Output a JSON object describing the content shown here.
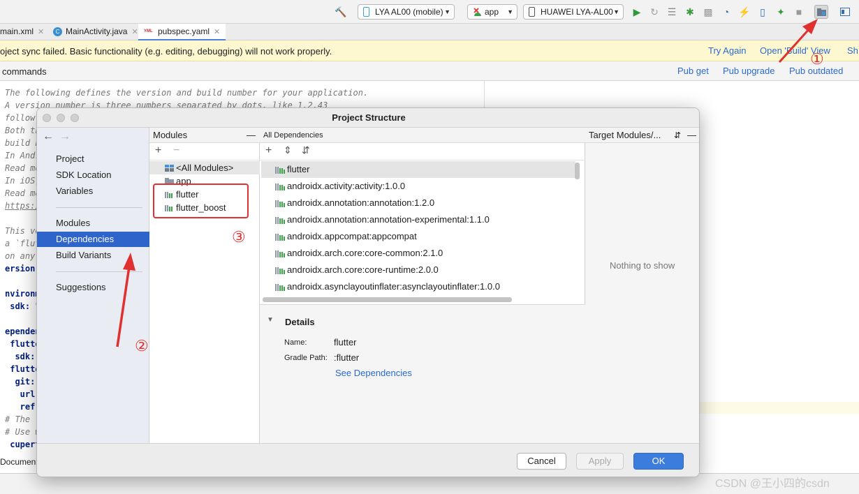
{
  "toolbar": {
    "device_combo": "LYA AL00 (mobile)",
    "run_config": "app",
    "target_device": "HUAWEI LYA-AL00",
    "icons": [
      "hammer-icon",
      "play-icon",
      "refresh-icon",
      "list-icon",
      "bug-icon",
      "coverage-icon",
      "profiler-icon",
      "flash-icon",
      "device-icon",
      "attach-icon",
      "stop-icon",
      "project-structure-icon",
      "layout-icon"
    ]
  },
  "tabs": [
    {
      "label": "main.xml"
    },
    {
      "label": "MainActivity.java",
      "badge": "C"
    },
    {
      "label": "pubspec.yaml",
      "badge": "YML"
    }
  ],
  "sync_banner": {
    "message": "oject sync failed. Basic functionality (e.g. editing, debugging) will not work properly.",
    "try_again": "Try Again",
    "open_view": "Open 'Build' View",
    "show": "Sh"
  },
  "pub_bar": {
    "label": "commands",
    "pub_get": "Pub get",
    "pub_upgrade": "Pub upgrade",
    "pub_outdated": "Pub outdated"
  },
  "editor_lines": [
    {
      "text": "The following defines the version and build number for your application.",
      "kind": "comment"
    },
    {
      "text": "A version number is three numbers separated by dots, like 1.2.43",
      "kind": "comment"
    },
    {
      "text": "follow",
      "kind": "comment"
    },
    {
      "text": "Both th",
      "kind": "comment"
    },
    {
      "text": "build b",
      "kind": "comment"
    },
    {
      "text": "In Andr",
      "kind": "comment"
    },
    {
      "text": "Read mo",
      "kind": "comment"
    },
    {
      "text": "In iOS,",
      "kind": "comment"
    },
    {
      "text": "Read mo",
      "kind": "comment"
    },
    {
      "text": "https:/",
      "kind": "link"
    },
    {
      "text": "",
      "kind": "plain"
    },
    {
      "text": "This ve",
      "kind": "comment"
    },
    {
      "text": "a `flut",
      "kind": "comment"
    },
    {
      "text": "on any ",
      "kind": "comment"
    },
    {
      "text": "ersion:",
      "kind": "key"
    },
    {
      "text": "",
      "kind": "plain"
    },
    {
      "text": "nvironme",
      "kind": "key"
    },
    {
      "text": " sdk: \"",
      "kind": "key"
    },
    {
      "text": "",
      "kind": "plain"
    },
    {
      "text": "ependen",
      "kind": "key"
    },
    {
      "text": " flutter",
      "kind": "key"
    },
    {
      "text": "  sdk:",
      "kind": "key"
    },
    {
      "text": " flutter",
      "kind": "key"
    },
    {
      "text": "  git:",
      "kind": "key"
    },
    {
      "text": "   url",
      "kind": "key"
    },
    {
      "text": "   ref",
      "kind": "key"
    },
    {
      "text": "# The ",
      "kind": "comment"
    },
    {
      "text": "# Use w",
      "kind": "comment"
    },
    {
      "text": " cuperti",
      "kind": "key"
    }
  ],
  "bottom_strip": {
    "label": "Document"
  },
  "dialog": {
    "title": "Project Structure",
    "nav_top": [
      "Project",
      "SDK Location",
      "Variables"
    ],
    "nav_mid": [
      "Modules",
      "Dependencies",
      "Build Variants"
    ],
    "nav_bottom": [
      "Suggestions"
    ],
    "selected_nav": "Dependencies",
    "modules_header": "Modules",
    "modules": [
      "<All Modules>",
      "app",
      "flutter",
      "flutter_boost"
    ],
    "deps_header": "All Dependencies",
    "dependencies": [
      "flutter",
      "androidx.activity:activity:1.0.0",
      "androidx.annotation:annotation:1.2.0",
      "androidx.annotation:annotation-experimental:1.1.0",
      "androidx.appcompat:appcompat",
      "androidx.arch.core:core-common:2.1.0",
      "androidx.arch.core:core-runtime:2.0.0",
      "androidx.asynclayoutinflater:asynclayoutinflater:1.0.0"
    ],
    "details": {
      "header": "Details",
      "name_label": "Name:",
      "name_value": "flutter",
      "path_label": "Gradle Path:",
      "path_value": ":flutter",
      "see_deps": "See Dependencies"
    },
    "target_header": "Target Modules/...",
    "nothing": "Nothing to show",
    "buttons": {
      "cancel": "Cancel",
      "apply": "Apply",
      "ok": "OK"
    }
  },
  "annotations": {
    "one": "①",
    "two": "②",
    "three": "③"
  },
  "watermark": "CSDN @王小四的csdn",
  "colors": {
    "accent": "#2f65ca",
    "annotation": "#e03030",
    "banner": "#fdf8cf",
    "link": "#2a6ad1"
  }
}
